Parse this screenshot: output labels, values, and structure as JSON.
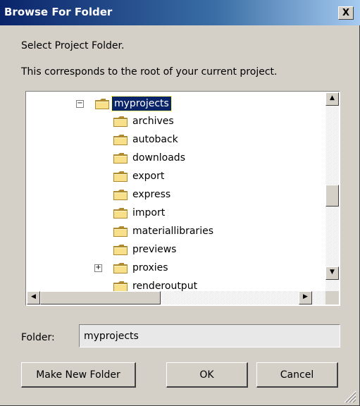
{
  "window": {
    "title": "Browse For Folder",
    "close_label": "X"
  },
  "dialog": {
    "heading": "Select Project Folder.",
    "description": "This corresponds to the root of your current project."
  },
  "tree": {
    "items": [
      {
        "label": "myprojects",
        "expander": "−",
        "selected": true
      },
      {
        "label": "archives"
      },
      {
        "label": "autoback"
      },
      {
        "label": "downloads"
      },
      {
        "label": "export"
      },
      {
        "label": "express"
      },
      {
        "label": "import"
      },
      {
        "label": "materiallibraries"
      },
      {
        "label": "previews"
      },
      {
        "label": "proxies",
        "expander": "+"
      },
      {
        "label": "renderoutput"
      }
    ],
    "scroll_up": "▲",
    "scroll_down": "▼",
    "scroll_left": "◀",
    "scroll_right": "▶"
  },
  "folder": {
    "label": "Folder:",
    "value": "myprojects"
  },
  "buttons": {
    "make_new_folder": "Make New Folder",
    "ok": "OK",
    "cancel": "Cancel"
  },
  "colors": {
    "titlebar": "#0a246a",
    "selection": "#0a246a",
    "face": "#d4d0c8",
    "folder_fill": "#f8e08a"
  },
  "icons": {
    "folder": "folder-icon",
    "close": "close-icon",
    "resize": "resize-grip-icon"
  }
}
